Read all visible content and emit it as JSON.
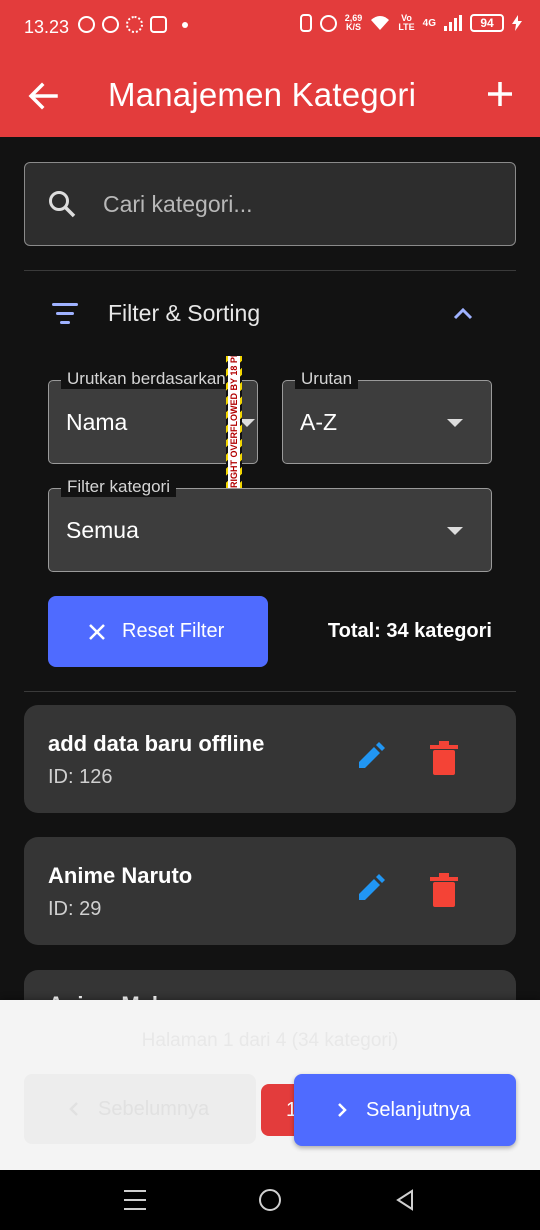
{
  "status_bar": {
    "time": "13.23",
    "speed_value": "2,69",
    "speed_unit": "K/S",
    "volte_top": "Vo",
    "volte_bottom": "LTE",
    "network": "4G",
    "battery": "94"
  },
  "app_bar": {
    "title": "Manajemen Kategori",
    "back_icon": "arrow-left-icon",
    "add_icon": "plus-icon"
  },
  "search": {
    "placeholder": "Cari kategori..."
  },
  "filter": {
    "title": "Filter & Sorting",
    "sort_by": {
      "label": "Urutkan berdasarkan",
      "value": "Nama"
    },
    "order": {
      "label": "Urutan",
      "value": "A-Z"
    },
    "category_filter": {
      "label": "Filter kategori",
      "value": "Semua"
    },
    "overflow_warning": "RIGHT OVERFLOWED BY 18 PIXELS",
    "reset_label": "Reset Filter",
    "total_text": "Total: 34 kategori"
  },
  "categories": [
    {
      "name": "add data baru offline",
      "id_text": "ID: 126"
    },
    {
      "name": "Anime Naruto",
      "id_text": "ID: 29"
    },
    {
      "name": "Anime Mak..."
    }
  ],
  "pagination": {
    "info": "Halaman 1 dari 4 (34 kategori)",
    "prev_label": "Sebelumnya",
    "current_page": "1",
    "next_label": "Selanjutnya"
  },
  "colors": {
    "primary_red": "#e33c3c",
    "accent_blue": "#4f6bff",
    "edit_blue": "#2196f3",
    "delete_red": "#f44336"
  }
}
